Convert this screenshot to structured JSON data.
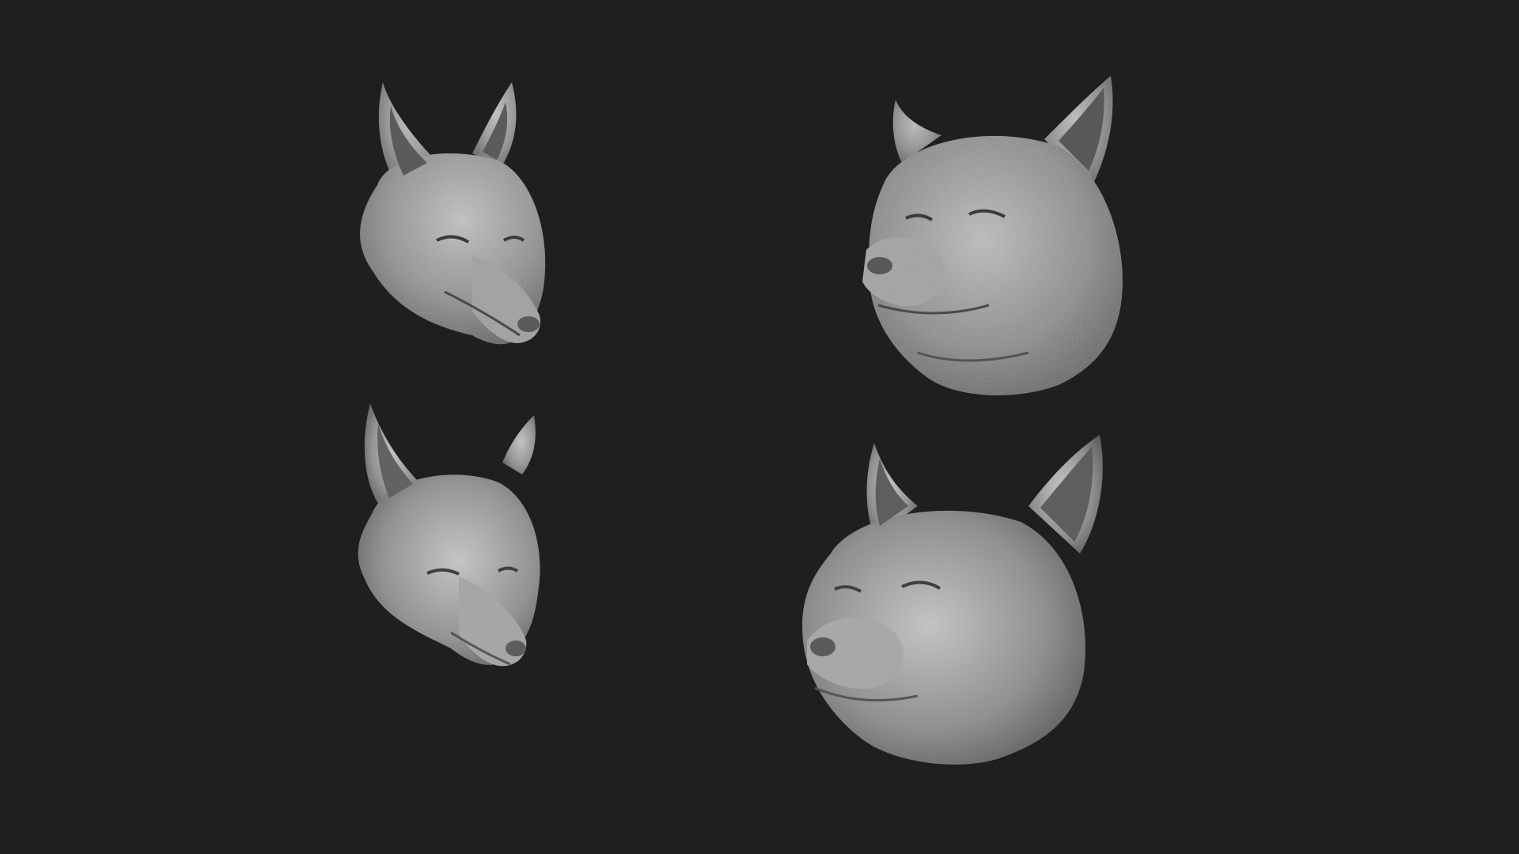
{
  "scene": {
    "background_color": "#1f1f1f",
    "clay_color": "#8c8c8c",
    "highlight_color": "#c6c6c6",
    "shadow_color": "#3a3a3a"
  },
  "sculpts": [
    {
      "subject": "fox-head",
      "surface": "fur-detailed",
      "facing": "three-quarter-right"
    },
    {
      "subject": "fox-head",
      "surface": "fur-detailed",
      "facing": "three-quarter-left"
    },
    {
      "subject": "fox-head",
      "surface": "smooth",
      "facing": "three-quarter-right"
    },
    {
      "subject": "fox-head",
      "surface": "smooth",
      "facing": "three-quarter-left"
    }
  ]
}
